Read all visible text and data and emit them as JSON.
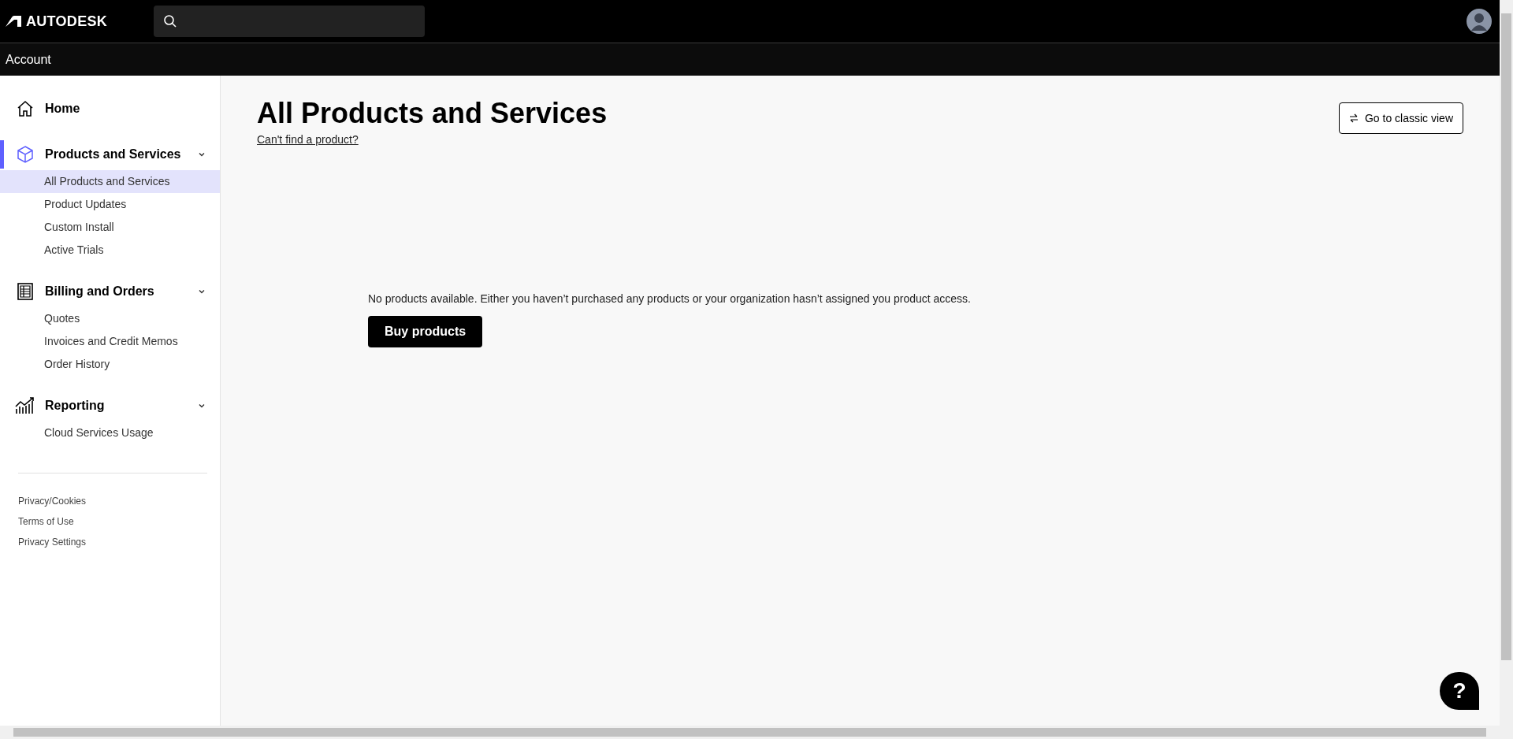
{
  "header": {
    "logo": "AUTODESK"
  },
  "subheader": {
    "title": "Account"
  },
  "sidebar": {
    "sections": [
      {
        "kind": "home",
        "label": "Home",
        "selected": false
      },
      {
        "kind": "products",
        "label": "Products and Services",
        "selected": true,
        "expanded": true,
        "items": [
          {
            "label": "All Products and Services",
            "selected": true
          },
          {
            "label": "Product Updates",
            "selected": false
          },
          {
            "label": "Custom Install",
            "selected": false
          },
          {
            "label": "Active Trials",
            "selected": false
          }
        ]
      },
      {
        "kind": "billing",
        "label": "Billing and Orders",
        "selected": false,
        "expanded": true,
        "items": [
          {
            "label": "Quotes",
            "selected": false
          },
          {
            "label": "Invoices and Credit Memos",
            "selected": false
          },
          {
            "label": "Order History",
            "selected": false
          }
        ]
      },
      {
        "kind": "reporting",
        "label": "Reporting",
        "selected": false,
        "expanded": true,
        "items": [
          {
            "label": "Cloud Services Usage",
            "selected": false
          }
        ]
      }
    ],
    "footer_links": [
      "Privacy/Cookies",
      "Terms of Use",
      "Privacy Settings"
    ]
  },
  "main": {
    "title": "All Products and Services",
    "help_link": "Can't find a product?",
    "classic_view_button": "Go to classic view",
    "empty_message": "No products available. Either you haven’t purchased any products or your organization hasn’t assigned you product access.",
    "buy_button": "Buy products"
  },
  "help_button": "?"
}
